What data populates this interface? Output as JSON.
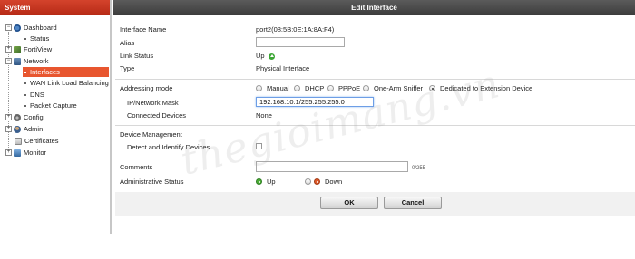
{
  "sidebar": {
    "header": "System",
    "items": [
      {
        "label": "Dashboard"
      },
      {
        "label": "Status"
      },
      {
        "label": "FortiView"
      },
      {
        "label": "Network"
      },
      {
        "label": "Interfaces"
      },
      {
        "label": "WAN Link Load Balancing"
      },
      {
        "label": "DNS"
      },
      {
        "label": "Packet Capture"
      },
      {
        "label": "Config"
      },
      {
        "label": "Admin"
      },
      {
        "label": "Certificates"
      },
      {
        "label": "Monitor"
      }
    ]
  },
  "dialog": {
    "title": "Edit Interface",
    "interface_name_label": "Interface Name",
    "interface_name_value": "port2(08:5B:0E:1A:8A:F4)",
    "alias_label": "Alias",
    "alias_value": "",
    "link_status_label": "Link Status",
    "link_status_value": "Up",
    "type_label": "Type",
    "type_value": "Physical Interface",
    "addressing_mode_label": "Addressing mode",
    "addressing_options": [
      "Manual",
      "DHCP",
      "PPPoE",
      "One-Arm Sniffer",
      "Dedicated to Extension Device"
    ],
    "addressing_selected": "Dedicated to Extension Device",
    "ip_mask_label": "IP/Network Mask",
    "ip_mask_value": "192.168.10.1/255.255.255.0",
    "connected_devices_label": "Connected Devices",
    "connected_devices_value": "None",
    "device_management_label": "Device Management",
    "detect_devices_label": "Detect and Identify Devices",
    "detect_devices_checked": false,
    "comments_label": "Comments",
    "comments_value": "",
    "comments_counter": "0/255",
    "admin_status_label": "Administrative Status",
    "admin_status_options": [
      "Up",
      "Down"
    ],
    "admin_status_selected": "Up"
  },
  "buttons": {
    "ok_label": "OK",
    "cancel_label": "Cancel"
  },
  "watermark": "thegioimang.vn",
  "colors": {
    "sidebar_header": "#c9361f",
    "selected_item": "#e8562f",
    "title_bar": "#4a4a4a",
    "status_up": "#3ca635"
  }
}
